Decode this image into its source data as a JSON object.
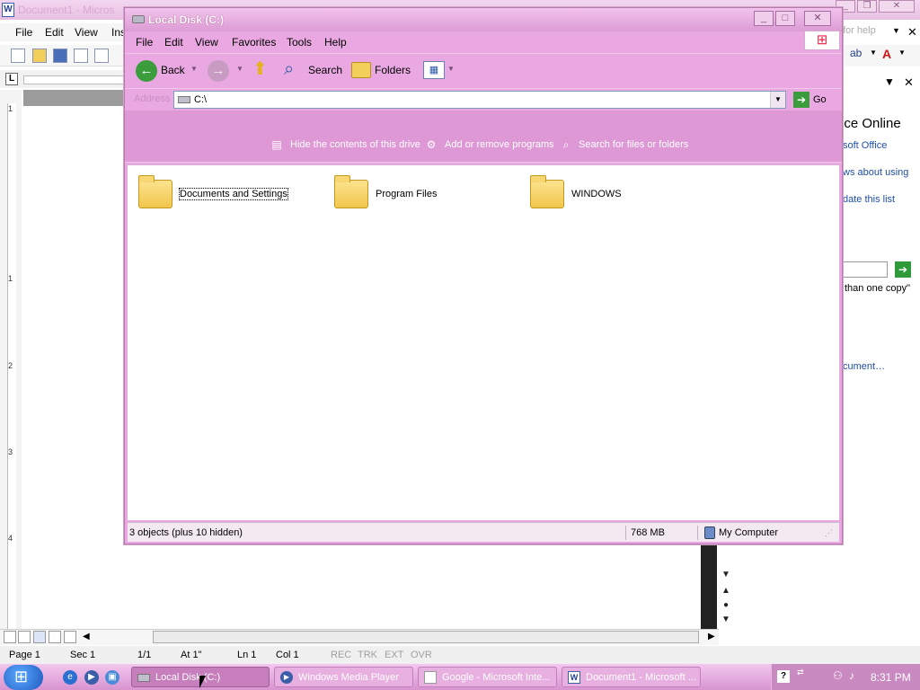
{
  "word": {
    "title": "Document1 - Micros",
    "menu": [
      "File",
      "Edit",
      "View",
      "Ins"
    ],
    "status": {
      "page": "Page 1",
      "sec": "Sec 1",
      "pages": "1/1",
      "at": "At 1\"",
      "ln": "Ln 1",
      "col": "Col 1",
      "rec": "REC",
      "trk": "TRK",
      "ext": "EXT",
      "ovr": "OVR"
    },
    "ruler_numbers": [
      "1",
      "1",
      "2",
      "3",
      "4"
    ],
    "ask_box": "for help",
    "task_pane": {
      "heading": "ice Online",
      "links": [
        "soft Office",
        "ws about using",
        "date this list",
        "cument…"
      ],
      "text": "than one copy\""
    }
  },
  "explorer": {
    "title": "Local Disk (C:)",
    "menu": [
      "File",
      "Edit",
      "View",
      "Favorites",
      "Tools",
      "Help"
    ],
    "toolbar": {
      "back": "Back",
      "search": "Search",
      "folders": "Folders"
    },
    "address": {
      "label": "Address",
      "value": "C:\\",
      "go": "Go"
    },
    "tasks": [
      "Hide the contents of this drive",
      "Add or remove programs",
      "Search for files or folders"
    ],
    "items": [
      {
        "name": "Documents and Settings"
      },
      {
        "name": "Program Files"
      },
      {
        "name": "WINDOWS"
      }
    ],
    "status": {
      "objects": "3 objects (plus 10 hidden)",
      "size": "768 MB",
      "zone": "My Computer"
    }
  },
  "taskbar": {
    "tasks": [
      "Local Disk (C:)",
      "Windows Media Player",
      "Google - Microsoft Inte...",
      "Document1 - Microsoft ..."
    ],
    "clock": "8:31 PM"
  }
}
